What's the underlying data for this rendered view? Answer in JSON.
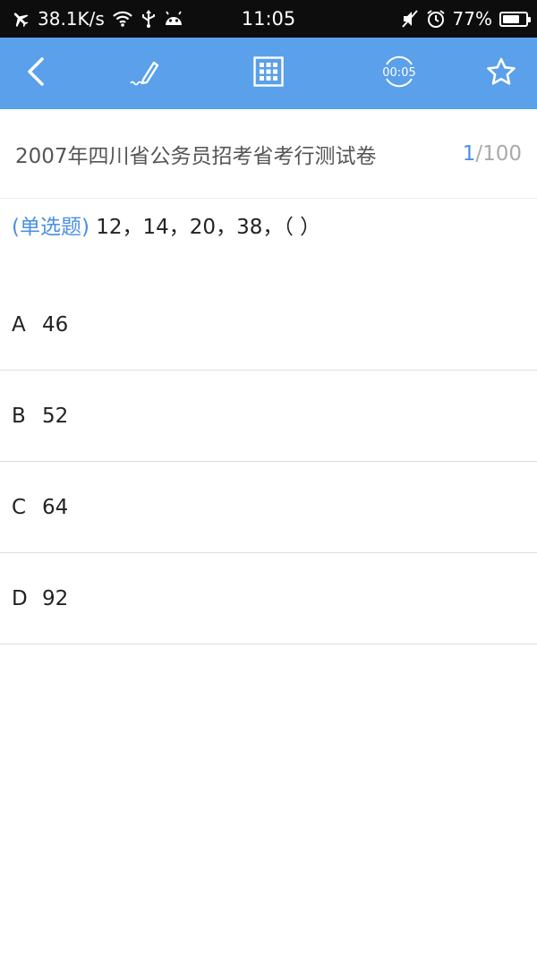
{
  "status_bar": {
    "net_speed": "38.1K/s",
    "time": "11:05",
    "battery_percent": "77%",
    "battery_level": 0.77,
    "icons": [
      "airplane-icon",
      "wifi-icon",
      "usb-icon",
      "android-icon",
      "mute-icon",
      "alarm-icon",
      "battery-icon"
    ]
  },
  "toolbar": {
    "color": "#5aa0ea",
    "timer": "00:05",
    "icons": [
      "back-arrow-icon",
      "pen-icon",
      "grid-icon",
      "timer-icon",
      "star-icon"
    ]
  },
  "exam": {
    "title": "2007年四川省公务员招考省考行测试卷",
    "current": "1",
    "separator_total": "/100"
  },
  "question": {
    "type_label": "(单选题)",
    "text": " 12，14，20，38，（ ）"
  },
  "options": [
    {
      "letter": "A",
      "value": "46"
    },
    {
      "letter": "B",
      "value": "52"
    },
    {
      "letter": "C",
      "value": "64"
    },
    {
      "letter": "D",
      "value": "92"
    }
  ],
  "colors": {
    "accent": "#4a90e2",
    "statusbar": "#0d0d0d"
  }
}
